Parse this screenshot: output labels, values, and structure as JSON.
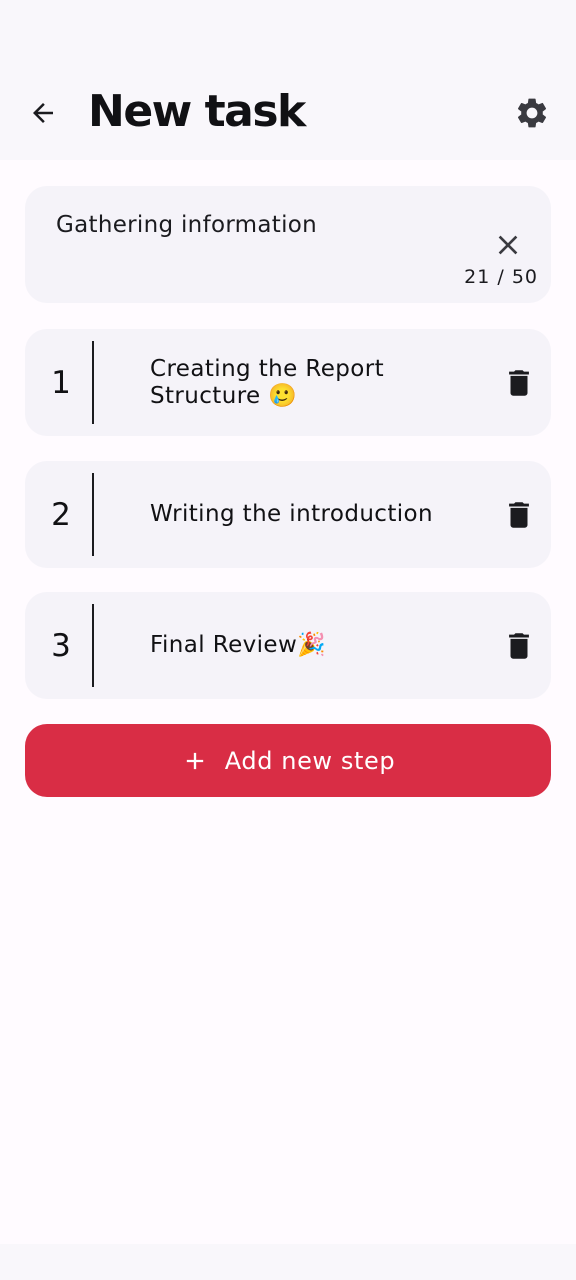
{
  "header": {
    "title": "New task",
    "back_icon": "arrow-back-icon",
    "settings_icon": "gear-icon"
  },
  "task": {
    "title_value": "Gathering information",
    "char_count": "21 / 50",
    "clear_icon": "close-icon"
  },
  "steps": [
    {
      "number": "1",
      "text": "Creating the Report Structure 🥲"
    },
    {
      "number": "2",
      "text": "Writing the introduction"
    },
    {
      "number": "3",
      "text": "Final Review🎉"
    }
  ],
  "actions": {
    "add_step_label": "Add new step",
    "add_icon": "plus-icon",
    "delete_icon": "trash-icon"
  },
  "colors": {
    "accent": "#d92d45",
    "card_background": "#f5f3f9",
    "app_bar_background": "#f9f7fb",
    "page_background": "#fffbff"
  }
}
